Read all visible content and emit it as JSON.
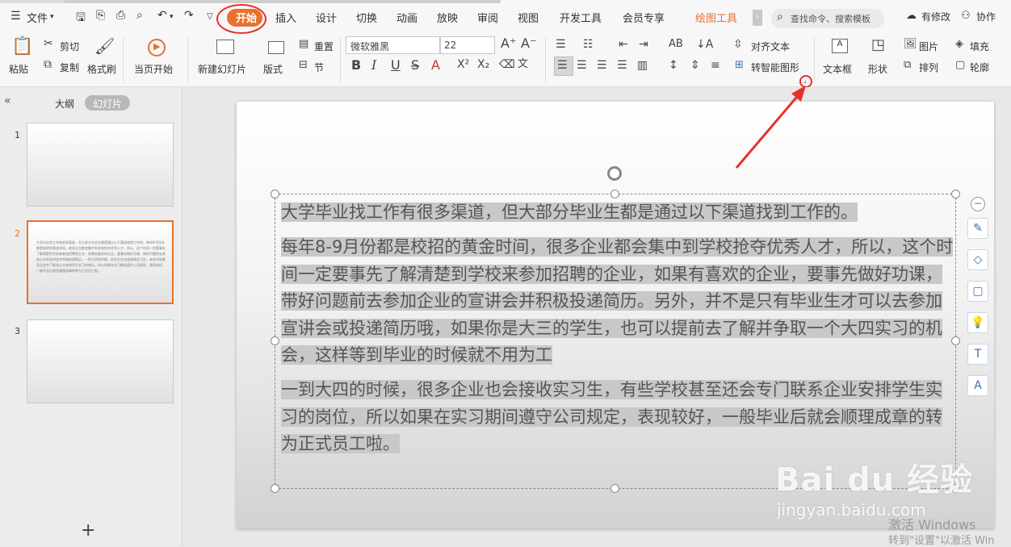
{
  "menu": {
    "file": "文件",
    "tabs": [
      "开始",
      "插入",
      "设计",
      "切换",
      "动画",
      "放映",
      "审阅",
      "视图",
      "开发工具",
      "会员专享"
    ],
    "drawing_tools": "绘图工具",
    "search": "查找命令、搜索模板",
    "modify": "有修改",
    "collab": "协作"
  },
  "ribbon": {
    "paste": "粘贴",
    "cut": "剪切",
    "copy": "复制",
    "format_painter": "格式刷",
    "from_current": "当页开始",
    "new_slide": "新建幻灯片",
    "layout": "版式",
    "reset": "重置",
    "section": "节",
    "font_name": "微软雅黑",
    "font_size": "22",
    "align_text": "对齐文本",
    "smart_art": "转智能图形",
    "text_box": "文本框",
    "shape": "形状",
    "picture": "图片",
    "fill": "填充",
    "arrange": "排列",
    "outline": "轮廓"
  },
  "sidebar": {
    "outline_tab": "大纲",
    "slides_tab": "幻灯片",
    "slide_numbers": [
      "1",
      "2",
      "3"
    ],
    "thumb_text": "大学毕业找工作有很多渠道，但大部分毕业生都是通过以下渠道找到工作的。每年8-9月份都是校招的黄金时间，很多企业都会集中到学校抢夺优秀人才，所以，这个时间一定要事先了解清楚到学校来参加招聘的企业，如果有喜欢的企业，要事先做好功课，带好问题前去参加企业的宣讲会并积极投递简历。一到大四的时候，很多企业也会接收实习生，有些学校甚至还会专门联系企业安排学生实习的岗位，所以如果在实习期间遵守公司规定，表现较好，一般毕业后就会顺理成章的转为正式员工啦。"
  },
  "slide": {
    "para1": "大学毕业找工作有很多渠道，但大部分毕业生都是通过以下渠道找到工作的。",
    "para2": "每年8-9月份都是校招的黄金时间，很多企业都会集中到学校抢夺优秀人才，所以，这个时间一定要事先了解清楚到学校来参加招聘的企业，如果有喜欢的企业，要事先做好功课，带好问题前去参加企业的宣讲会并积极投递简历。另外，并不是只有毕业生才可以去参加宣讲会或投递简历哦，如果你是大三的学生，也可以提前去了解并争取一个大四实习的机会，这样等到毕业的时候就不用为工",
    "para3": "一到大四的时候，很多企业也会接收实习生，有些学校甚至还会专门联系企业安排学生实习的岗位，所以如果在实习期间遵守公司规定，表现较好，一般毕业后就会顺理成章的转为正式员工啦。"
  },
  "watermark": {
    "brand": "Bai du 经验",
    "url": "jingyan.baidu.com",
    "activate1": "激活 Windows",
    "activate2": "转到\"设置\"以激活 Win"
  },
  "colors": {
    "accent": "#e8712e",
    "annotation": "#e8302a"
  }
}
